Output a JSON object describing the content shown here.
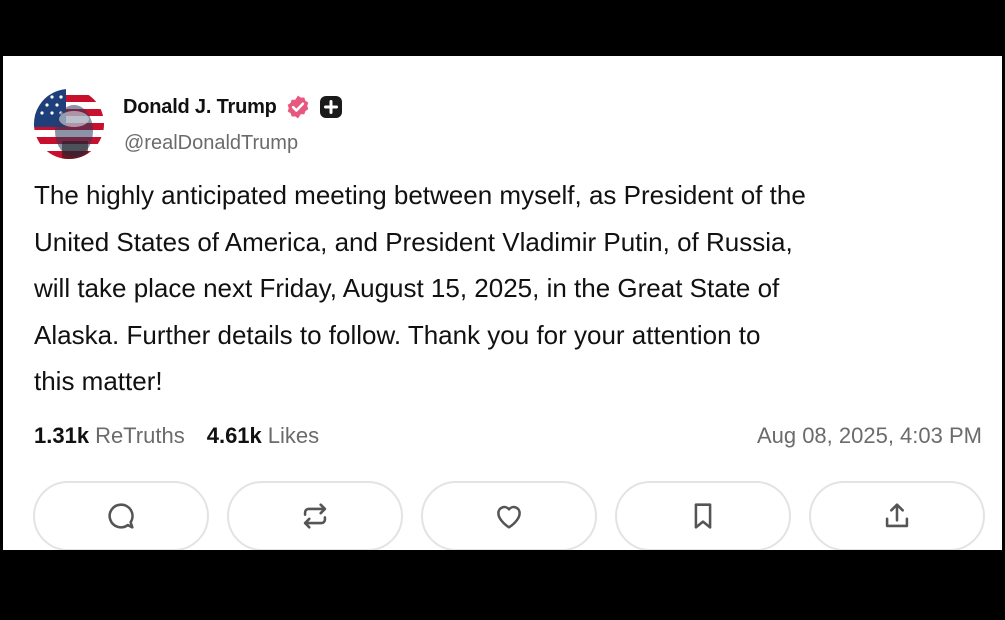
{
  "post": {
    "display_name": "Donald J. Trump",
    "handle": "@realDonaldTrump",
    "body": "The highly anticipated meeting between myself, as President of the\nUnited States of America, and President Vladimir Putin, of Russia,\nwill take place next Friday, August 15, 2025, in the Great State of\nAlaska. Further details to follow. Thank you for your attention to\nthis matter!",
    "retruths_count": "1.31k",
    "retruths_label": "ReTruths",
    "likes_count": "4.61k",
    "likes_label": "Likes",
    "timestamp": "Aug 08, 2025, 4:03 PM"
  },
  "badges": {
    "verified_icon": "verified-badge-icon",
    "verified_color": "#e8577e",
    "plus_icon": "plus-badge-icon"
  },
  "actions": [
    {
      "icon": "reply-icon"
    },
    {
      "icon": "retruth-icon"
    },
    {
      "icon": "like-heart-icon"
    },
    {
      "icon": "bookmark-icon"
    },
    {
      "icon": "share-icon"
    }
  ],
  "colors": {
    "background": "#ffffff",
    "text": "#111111",
    "muted": "#6b6b6b",
    "button_border": "#e3e3e3"
  }
}
